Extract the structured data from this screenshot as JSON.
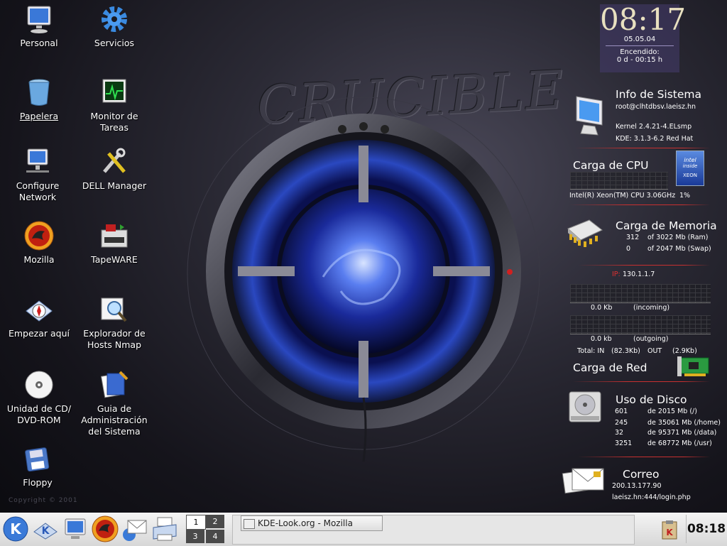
{
  "desktop": {
    "wallpaper_title": "CRUCIBLE",
    "copyright": "Copyright © 2001",
    "icons_left": [
      "Personal",
      "Papelera",
      "Configure\nNetwork",
      "Mozilla",
      "Empezar aquí",
      "Unidad de CD/\nDVD-ROM",
      "Floppy"
    ],
    "icons_right": [
      "Servicios",
      "Monitor de\nTareas",
      "DELL Manager",
      "TapeWARE",
      "Explorador de\nHosts Nmap",
      "Guia de\nAdministración\ndel Sistema"
    ]
  },
  "clock": {
    "time": "08:17",
    "date": "05.05.04",
    "uptime_label": "Encendido:",
    "uptime": "0 d - 00:15 h"
  },
  "sysinfo": {
    "title": "Info de Sistema",
    "user": "root@clhtdbsv.laeisz.hn",
    "kernel": "Kernel 2.4.21-4.ELsmp",
    "kde": "KDE: 3.1.3-6.2 Red Hat"
  },
  "cpu": {
    "title": "Carga de CPU",
    "desc": "Intel(R) Xeon(TM) CPU 3.06GHz",
    "load": "1%",
    "chip_brand": "intel",
    "chip_inside": "inside",
    "chip_model": "XEON"
  },
  "memory": {
    "title": "Carga de Memoria",
    "ram_used": "312",
    "ram_total": "of 3022 Mb (Ram)",
    "swap_used": "0",
    "swap_total": "of 2047 Mb (Swap)"
  },
  "network": {
    "ip_label": "IP:",
    "ip": "130.1.1.7",
    "in_val": "0.0 Kb",
    "in_label": "(incoming)",
    "out_val": "0.0 kb",
    "out_label": "(outgoing)",
    "total_in_label": "Total: IN",
    "total_in": "(82.3Kb)",
    "total_out_label": "OUT",
    "total_out": "(2.9Kb)",
    "title": "Carga de Red"
  },
  "disk": {
    "title": "Uso de Disco",
    "rows": [
      {
        "used": "601",
        "total": "de 2015 Mb (/)"
      },
      {
        "used": "245",
        "total": "de 35061 Mb (/home)"
      },
      {
        "used": "32",
        "total": "de 95371 Mb (/data)"
      },
      {
        "used": "3251",
        "total": "de 68772 Mb (/usr)"
      }
    ]
  },
  "mail": {
    "title": "Correo",
    "server": "200.13.177.90",
    "url": "laeisz.hn:444/login.php"
  },
  "taskbar": {
    "pager": [
      "1",
      "2",
      "3",
      "4"
    ],
    "task": "KDE-Look.org - Mozilla",
    "clock": "08:18"
  },
  "colors": {
    "accent_red": "#c83030",
    "taskbar_bg": "#e0e0e0",
    "clock_bg": "#46406e"
  }
}
